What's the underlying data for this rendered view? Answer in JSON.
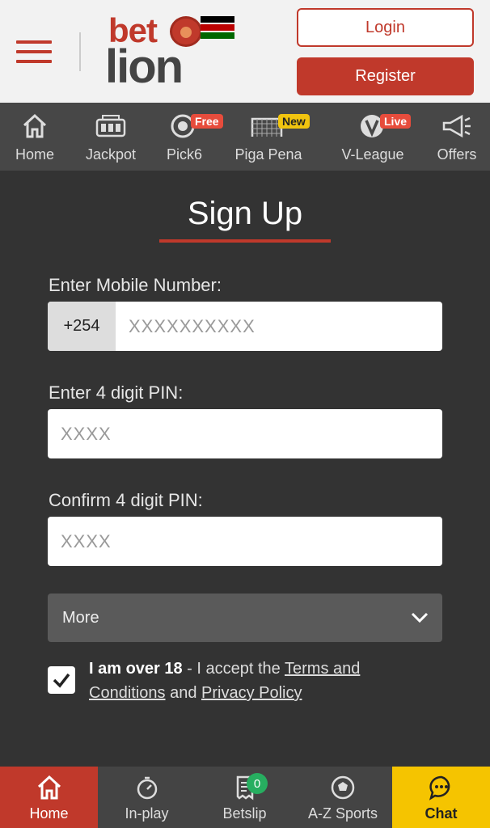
{
  "header": {
    "logo_top": "bet",
    "logo_bottom": "lion",
    "login_label": "Login",
    "register_label": "Register"
  },
  "top_nav": [
    {
      "label": "Home",
      "icon": "home-icon"
    },
    {
      "label": "Jackpot",
      "icon": "slot-machine-icon"
    },
    {
      "label": "Pick6",
      "icon": "lottery-icon",
      "badge": "Free"
    },
    {
      "label": "Piga Pena",
      "icon": "goal-net-icon",
      "badge": "New"
    },
    {
      "label": "V-League",
      "icon": "v-league-icon",
      "badge": "Live"
    },
    {
      "label": "Offers",
      "icon": "megaphone-icon"
    }
  ],
  "form": {
    "title": "Sign Up",
    "mobile_label": "Enter Mobile Number:",
    "country_code": "+254",
    "mobile_placeholder": "XXXXXXXXXX",
    "pin_label": "Enter 4 digit PIN:",
    "pin_placeholder": "XXXX",
    "confirm_label": "Confirm 4 digit PIN:",
    "confirm_placeholder": "XXXX",
    "more_label": "More",
    "age_bold": "I am over 18",
    "accept_text": " - I accept the ",
    "terms_link": "Terms and Conditions",
    "and_text": " and ",
    "privacy_link": "Privacy Policy",
    "checked": true
  },
  "bottom_nav": [
    {
      "label": "Home",
      "icon": "home-icon"
    },
    {
      "label": "In-play",
      "icon": "stopwatch-icon"
    },
    {
      "label": "Betslip",
      "icon": "receipt-icon",
      "count": "0"
    },
    {
      "label": "A-Z Sports",
      "icon": "soccer-ball-icon"
    },
    {
      "label": "Chat",
      "icon": "chat-icon"
    }
  ],
  "colors": {
    "brand_red": "#c0392b",
    "chat_yellow": "#f5c400",
    "badge_green": "#27ae60"
  }
}
